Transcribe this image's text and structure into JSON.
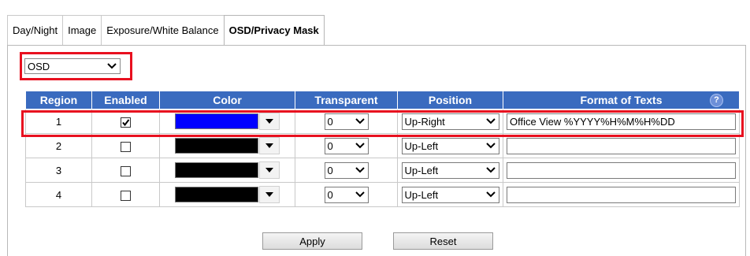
{
  "tabs": [
    {
      "label": "Day/Night",
      "active": false
    },
    {
      "label": "Image",
      "active": false
    },
    {
      "label": "Exposure/White Balance",
      "active": false
    },
    {
      "label": "OSD/Privacy Mask",
      "active": true
    }
  ],
  "mode_select": {
    "value": "OSD"
  },
  "table": {
    "headers": [
      "Region",
      "Enabled",
      "Color",
      "Transparent",
      "Position",
      "Format of Texts"
    ],
    "help_icon": "help-icon",
    "rows": [
      {
        "region": "1",
        "enabled": true,
        "color": "#0000ff",
        "transparent": "0",
        "position": "Up-Right",
        "format": "Office View %YYYY%H%M%H%DD"
      },
      {
        "region": "2",
        "enabled": false,
        "color": "#000000",
        "transparent": "0",
        "position": "Up-Left",
        "format": ""
      },
      {
        "region": "3",
        "enabled": false,
        "color": "#000000",
        "transparent": "0",
        "position": "Up-Left",
        "format": ""
      },
      {
        "region": "4",
        "enabled": false,
        "color": "#000000",
        "transparent": "0",
        "position": "Up-Left",
        "format": ""
      }
    ]
  },
  "buttons": {
    "apply": "Apply",
    "reset": "Reset"
  },
  "colors": {
    "header_bg": "#3a6bbf",
    "highlight": "#e8101f"
  }
}
